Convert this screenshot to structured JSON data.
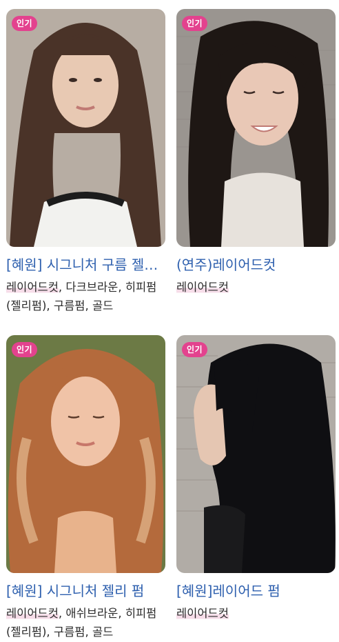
{
  "cards": [
    {
      "badge": "인기",
      "title": "[혜원] 시그니처 구름 젤리펌",
      "tags": [
        "레이어드컷",
        "다크브라운",
        "히피펌(젤리펌)",
        "구름펌",
        "골드"
      ],
      "colors": {
        "bg": "#b7ada3",
        "hair": "#4a3328",
        "skin": "#e8c9b3",
        "shirt": "#f2f2ef",
        "accent": "#1c1c1c"
      }
    },
    {
      "badge": "인기",
      "title": "(연주)레이어드컷",
      "tags": [
        "레이어드컷"
      ],
      "colors": {
        "bg": "#9a9590",
        "hair": "#1e1714",
        "skin": "#e9c8b6",
        "shirt": "#e7e2dc",
        "accent": "#c9c2bb"
      }
    },
    {
      "badge": "인기",
      "title": "[혜원] 시그니처 젤리 펌",
      "tags": [
        "레이어드컷",
        "애쉬브라운",
        "히피펌(젤리펌)",
        "구름펌",
        "골드"
      ],
      "colors": {
        "bg": "#6c7a45",
        "hair": "#b46a3c",
        "skin": "#f0c3a7",
        "shirt": "#e8b38c",
        "accent": "#f3d0a8"
      }
    },
    {
      "badge": "인기",
      "title": "[혜원]레이어드 펌",
      "tags": [
        "레이어드컷"
      ],
      "colors": {
        "bg": "#b1aca6",
        "hair": "#0f0f12",
        "skin": "#e5c6b2",
        "shirt": "#1a1a1c",
        "accent": "#8d8781"
      }
    }
  ]
}
